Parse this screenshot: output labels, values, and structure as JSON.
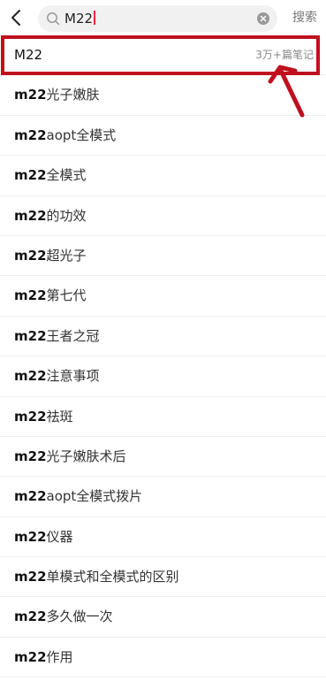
{
  "search": {
    "query": "M22",
    "button_label": "搜索"
  },
  "suggestions": [
    {
      "prefix": "M22",
      "suffix": "",
      "count": "3万+篇笔记"
    },
    {
      "prefix": "m22",
      "suffix": "光子嫩肤",
      "count": ""
    },
    {
      "prefix": "m22",
      "suffix": "aopt全模式",
      "count": ""
    },
    {
      "prefix": "m22",
      "suffix": "全模式",
      "count": ""
    },
    {
      "prefix": "m22",
      "suffix": "的功效",
      "count": ""
    },
    {
      "prefix": "m22",
      "suffix": "超光子",
      "count": ""
    },
    {
      "prefix": "m22",
      "suffix": "第七代",
      "count": ""
    },
    {
      "prefix": "m22",
      "suffix": "王者之冠",
      "count": ""
    },
    {
      "prefix": "m22",
      "suffix": "注意事项",
      "count": ""
    },
    {
      "prefix": "m22",
      "suffix": "祛斑",
      "count": ""
    },
    {
      "prefix": "m22",
      "suffix": "光子嫩肤术后",
      "count": ""
    },
    {
      "prefix": "m22",
      "suffix": "aopt全模式拨片",
      "count": ""
    },
    {
      "prefix": "m22",
      "suffix": "仪器",
      "count": ""
    },
    {
      "prefix": "m22",
      "suffix": "单模式和全模式的区别",
      "count": ""
    },
    {
      "prefix": "m22",
      "suffix": "多久做一次",
      "count": ""
    },
    {
      "prefix": "m22",
      "suffix": "作用",
      "count": ""
    }
  ],
  "colors": {
    "highlight": "#c0101e",
    "caret": "#ff2442"
  }
}
